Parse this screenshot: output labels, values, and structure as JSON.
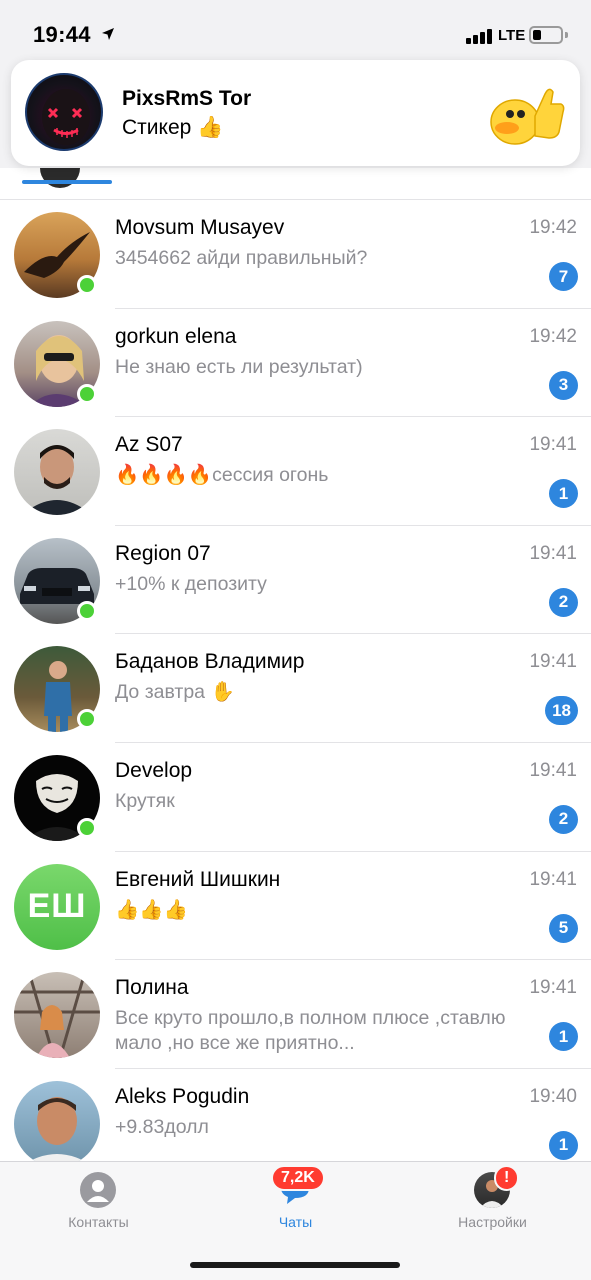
{
  "status_bar": {
    "time": "19:44",
    "network": "LTE",
    "icons": [
      "location-arrow-icon",
      "signal-icon",
      "battery-icon"
    ]
  },
  "notification": {
    "title": "PixsRmS Tor",
    "text": "Стикер 👍",
    "avatar_icon": "neon-mask-avatar",
    "sticker_icon": "duck-thumbs-up-sticker"
  },
  "chats": [
    {
      "name": "Movsum Musayev",
      "time": "19:42",
      "preview": "3454662 айди правильный?",
      "unread": "7",
      "online": true,
      "avatar_icon": "eagle-photo"
    },
    {
      "name": "gorkun elena",
      "time": "19:42",
      "preview": "Не знаю есть ли результат)",
      "unread": "3",
      "online": true,
      "avatar_icon": "woman-photo"
    },
    {
      "name": "Az S07",
      "time": "19:41",
      "preview": "🔥🔥🔥🔥сессия огонь",
      "unread": "1",
      "online": false,
      "avatar_icon": "man-photo"
    },
    {
      "name": "Region 07",
      "time": "19:41",
      "preview": "+10% к депозиту",
      "unread": "2",
      "online": true,
      "avatar_icon": "car-photo"
    },
    {
      "name": "Баданов Владимир",
      "time": "19:41",
      "preview": "До завтра ✋",
      "unread": "18",
      "online": true,
      "avatar_icon": "man-suit-photo"
    },
    {
      "name": "Develop",
      "time": "19:41",
      "preview": "Крутяк",
      "unread": "2",
      "online": true,
      "avatar_icon": "anonymous-mask-avatar"
    },
    {
      "name": "Евгений Шишкин",
      "time": "19:41",
      "preview": "👍👍👍",
      "unread": "5",
      "online": false,
      "avatar_initials": "ЕШ"
    },
    {
      "name": "Полина",
      "time": "19:41",
      "preview": "Все круто прошло,в полном плюсе ,ставлю мало ,но все же приятно...",
      "unread": "1",
      "online": false,
      "avatar_icon": "girl-bridge-photo"
    },
    {
      "name": "Aleks Pogudin",
      "time": "19:40",
      "preview": "+9.83долл",
      "unread": "1",
      "online": false,
      "avatar_icon": "man-portrait-photo"
    }
  ],
  "tab_bar": {
    "contacts_label": "Контакты",
    "chats_label": "Чаты",
    "chats_badge": "7,2K",
    "settings_label": "Настройки",
    "settings_badge": "!"
  },
  "colors": {
    "accent": "#2e86de",
    "online": "#4cd137",
    "badge_red": "#ff3b30",
    "secondary_text": "#8e8e93"
  }
}
